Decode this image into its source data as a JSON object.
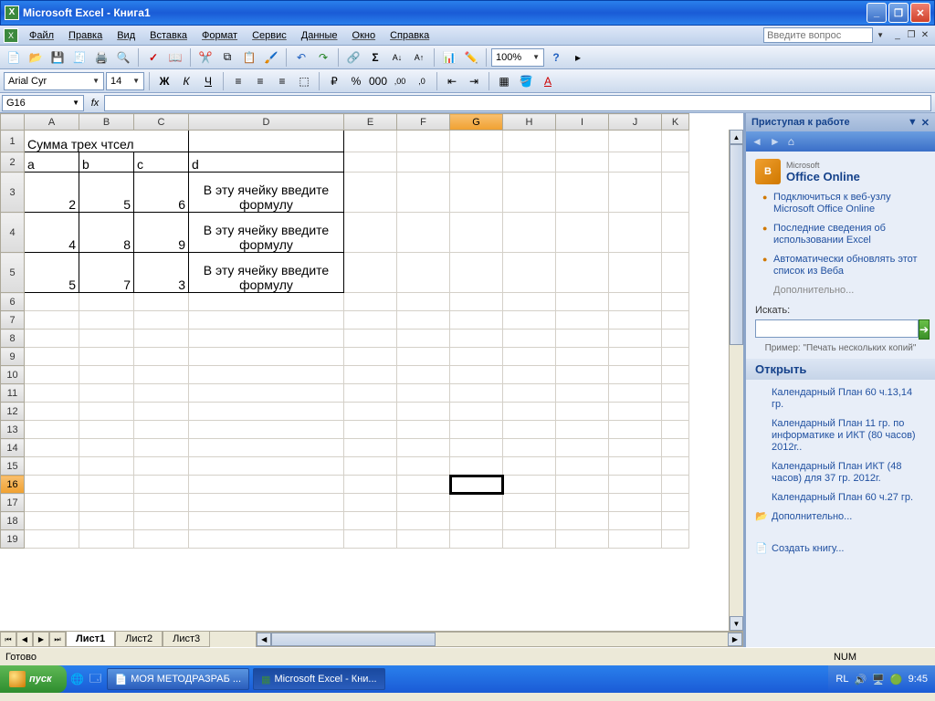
{
  "window": {
    "title": "Microsoft Excel - Книга1"
  },
  "menu": {
    "file": "Файл",
    "edit": "Правка",
    "view": "Вид",
    "insert": "Вставка",
    "format": "Формат",
    "tools": "Сервис",
    "data": "Данные",
    "window": "Окно",
    "help": "Справка",
    "ask_placeholder": "Введите вопрос"
  },
  "namebox": "G16",
  "font": {
    "name": "Arial Cyr",
    "size": "14"
  },
  "zoom": "100%",
  "columns": [
    "A",
    "B",
    "C",
    "D",
    "E",
    "F",
    "G",
    "H",
    "I",
    "J",
    "K"
  ],
  "rows": [
    "1",
    "2",
    "3",
    "4",
    "5",
    "6",
    "7",
    "8",
    "9",
    "10",
    "11",
    "12",
    "13",
    "14",
    "15",
    "16",
    "17",
    "18",
    "19"
  ],
  "cells": {
    "A1": "Сумма трех чтсел",
    "A2": "a",
    "B2": "b",
    "C2": "c",
    "D2": "d",
    "A3": "2",
    "B3": "5",
    "C3": "6",
    "D3": "В эту ячейку введите формулу",
    "A4": "4",
    "B4": "8",
    "C4": "9",
    "D4": "В эту ячейку введите формулу",
    "A5": "5",
    "B5": "7",
    "C5": "3",
    "D5": "В эту ячейку введите формулу"
  },
  "col_widths": {
    "A": 60,
    "B": 60,
    "C": 60,
    "D": 170,
    "E": 58,
    "F": 58,
    "G": 58,
    "H": 58,
    "I": 58,
    "J": 58,
    "K": 30
  },
  "row_heights": {
    "1": 24,
    "2": 22,
    "3": 44,
    "4": 44,
    "5": 44
  },
  "active_cell": "G16",
  "tabs": {
    "t1": "Лист1",
    "t2": "Лист2",
    "t3": "Лист3"
  },
  "status": {
    "ready": "Готово",
    "num": "NUM"
  },
  "taskpane": {
    "title": "Приступая к работе",
    "office": "Office Online",
    "office_ms": "Microsoft",
    "links": [
      "Подключиться к веб-узлу Microsoft Office Online",
      "Последние сведения об использовании Excel",
      "Автоматически обновлять этот список из Веба"
    ],
    "more": "Дополнительно...",
    "search_label": "Искать:",
    "hint": "Пример: \"Печать нескольких копий\"",
    "open": "Открыть",
    "files": [
      "Календарный План 60 ч.13,14 гр.",
      "Календарный План 11 гр. по информатике и ИКТ (80 часов) 2012г..",
      "Календарный План ИКТ (48 часов)  для 37 гр. 2012г.",
      "Календарный План 60 ч.27 гр."
    ],
    "more2": "Дополнительно...",
    "create": "Создать книгу..."
  },
  "taskbar": {
    "start": "пуск",
    "app1": "МОЯ МЕТОДРАЗРАБ ...",
    "app2": "Microsoft Excel - Кни...",
    "lang": "RL",
    "time": "9:45"
  }
}
